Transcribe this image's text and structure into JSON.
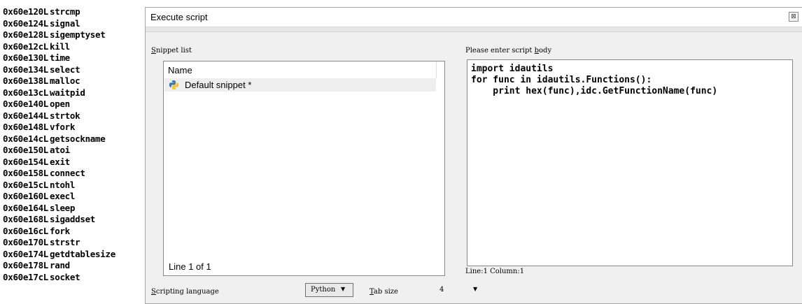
{
  "output": {
    "rows": [
      {
        "addr": "0x60e120L",
        "name": "strcmp"
      },
      {
        "addr": "0x60e124L",
        "name": "signal"
      },
      {
        "addr": "0x60e128L",
        "name": "sigemptyset"
      },
      {
        "addr": "0x60e12cL",
        "name": "kill"
      },
      {
        "addr": "0x60e130L",
        "name": "time"
      },
      {
        "addr": "0x60e134L",
        "name": "select"
      },
      {
        "addr": "0x60e138L",
        "name": "malloc"
      },
      {
        "addr": "0x60e13cL",
        "name": "waitpid"
      },
      {
        "addr": "0x60e140L",
        "name": "open"
      },
      {
        "addr": "0x60e144L",
        "name": "strtok"
      },
      {
        "addr": "0x60e148L",
        "name": "vfork"
      },
      {
        "addr": "0x60e14cL",
        "name": "getsockname"
      },
      {
        "addr": "0x60e150L",
        "name": "atoi"
      },
      {
        "addr": "0x60e154L",
        "name": "exit"
      },
      {
        "addr": "0x60e158L",
        "name": "connect"
      },
      {
        "addr": "0x60e15cL",
        "name": "ntohl"
      },
      {
        "addr": "0x60e160L",
        "name": "execl"
      },
      {
        "addr": "0x60e164L",
        "name": "sleep"
      },
      {
        "addr": "0x60e168L",
        "name": "sigaddset"
      },
      {
        "addr": "0x60e16cL",
        "name": "fork"
      },
      {
        "addr": "0x60e170L",
        "name": "strstr"
      },
      {
        "addr": "0x60e174L",
        "name": "getdtablesize"
      },
      {
        "addr": "0x60e178L",
        "name": "rand"
      },
      {
        "addr": "0x60e17cL",
        "name": "socket"
      }
    ]
  },
  "dialog": {
    "title": "Execute script",
    "close_icon": "close-icon",
    "snippet_list": {
      "label_mnemonic": "S",
      "label_rest": "nippet list",
      "column_header": "Name",
      "items": [
        {
          "icon": "python-icon",
          "label": "Default snippet *"
        }
      ],
      "status": "Line 1 of 1"
    },
    "script_body": {
      "label_before": "Please enter script ",
      "label_mnemonic": "b",
      "label_after": "ody",
      "code": "import idautils\nfor func in idautils.Functions():\n    print hex(func),idc.GetFunctionName(func)",
      "status": "Line:1  Column:1"
    },
    "footer": {
      "lang_label_mnemonic": "S",
      "lang_label_rest": "cripting language",
      "lang_value": "Python",
      "tab_label_mnemonic": "T",
      "tab_label_rest": "ab size",
      "tab_value": "4"
    }
  }
}
